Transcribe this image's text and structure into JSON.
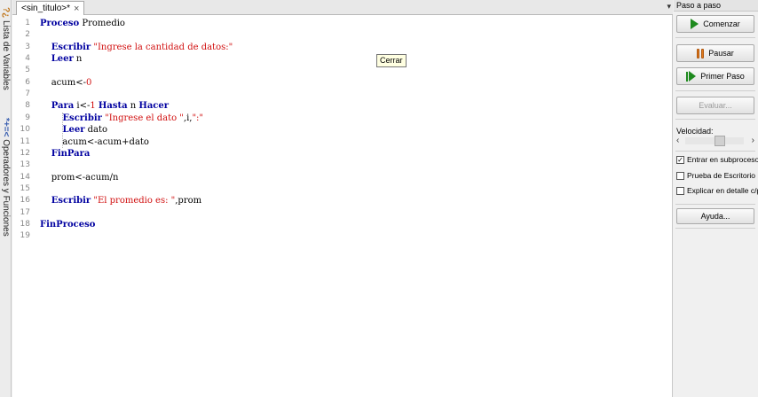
{
  "sidebar_left": {
    "variables_label": "Lista de Variables",
    "operators_label": "Operadores y Funciones",
    "vars_icon": "*+=<",
    "ops_icon": "?¿"
  },
  "tab": {
    "title": "<sin_titulo>*",
    "close_glyph": "×"
  },
  "tab_menu_glyph": "▾",
  "code_lines": [
    {
      "n": "1",
      "parts": [
        [
          "kw",
          "Proceso"
        ],
        [
          "plain",
          " Promedio"
        ]
      ]
    },
    {
      "n": "2",
      "parts": []
    },
    {
      "n": "3",
      "parts": [
        [
          "plain",
          "    "
        ],
        [
          "kw",
          "Escribir"
        ],
        [
          "plain",
          " "
        ],
        [
          "str",
          "\"Ingrese la cantidad de datos:\""
        ]
      ]
    },
    {
      "n": "4",
      "parts": [
        [
          "plain",
          "    "
        ],
        [
          "kw",
          "Leer"
        ],
        [
          "plain",
          " n"
        ]
      ]
    },
    {
      "n": "5",
      "parts": []
    },
    {
      "n": "6",
      "parts": [
        [
          "plain",
          "    acum<-"
        ],
        [
          "num",
          "0"
        ]
      ]
    },
    {
      "n": "7",
      "parts": []
    },
    {
      "n": "8",
      "parts": [
        [
          "plain",
          "    "
        ],
        [
          "kw",
          "Para"
        ],
        [
          "plain",
          " i<-"
        ],
        [
          "num",
          "1"
        ],
        [
          "plain",
          " "
        ],
        [
          "kw",
          "Hasta"
        ],
        [
          "plain",
          " n "
        ],
        [
          "kw",
          "Hacer"
        ]
      ]
    },
    {
      "n": "9",
      "parts": [
        [
          "plain",
          "        "
        ],
        [
          "kw",
          "Escribir"
        ],
        [
          "plain",
          " "
        ],
        [
          "str",
          "\"Ingrese el dato \""
        ],
        [
          "plain",
          ",i,"
        ],
        [
          "str",
          "\":\""
        ]
      ]
    },
    {
      "n": "10",
      "parts": [
        [
          "plain",
          "        "
        ],
        [
          "kw",
          "Leer"
        ],
        [
          "plain",
          " dato"
        ]
      ]
    },
    {
      "n": "11",
      "parts": [
        [
          "plain",
          "        acum<-acum+dato"
        ]
      ]
    },
    {
      "n": "12",
      "parts": [
        [
          "plain",
          "    "
        ],
        [
          "kw",
          "FinPara"
        ]
      ]
    },
    {
      "n": "13",
      "parts": []
    },
    {
      "n": "14",
      "parts": [
        [
          "plain",
          "    prom<-acum/n"
        ]
      ]
    },
    {
      "n": "15",
      "parts": []
    },
    {
      "n": "16",
      "parts": [
        [
          "plain",
          "    "
        ],
        [
          "kw",
          "Escribir"
        ],
        [
          "plain",
          " "
        ],
        [
          "str",
          "\"El promedio es: \""
        ],
        [
          "plain",
          ",prom"
        ]
      ]
    },
    {
      "n": "17",
      "parts": []
    },
    {
      "n": "18",
      "parts": [
        [
          "kw",
          "FinProceso"
        ]
      ]
    },
    {
      "n": "19",
      "parts": []
    }
  ],
  "tooltip": "Cerrar",
  "panel": {
    "title": "Paso a paso",
    "start_label": "Comenzar",
    "pause_label": "Pausar",
    "first_step_label": "Primer Paso",
    "evaluate_label": "Evaluar...",
    "speed_label": "Velocidad:",
    "speed_level": 0.62,
    "speed_left": "‹",
    "speed_right": "›",
    "checkboxes": [
      {
        "label": "Entrar en subprocesos",
        "checked": true
      },
      {
        "label": "Prueba de Escritorio",
        "checked": false
      },
      {
        "label": "Explicar en detalle c/paso",
        "checked": false
      }
    ],
    "help_label": "Ayuda..."
  },
  "colors": {
    "keyword": "#0000a0",
    "string": "#d11010",
    "play_green": "#1e8a1e",
    "pause_orange": "#e07a1a"
  }
}
